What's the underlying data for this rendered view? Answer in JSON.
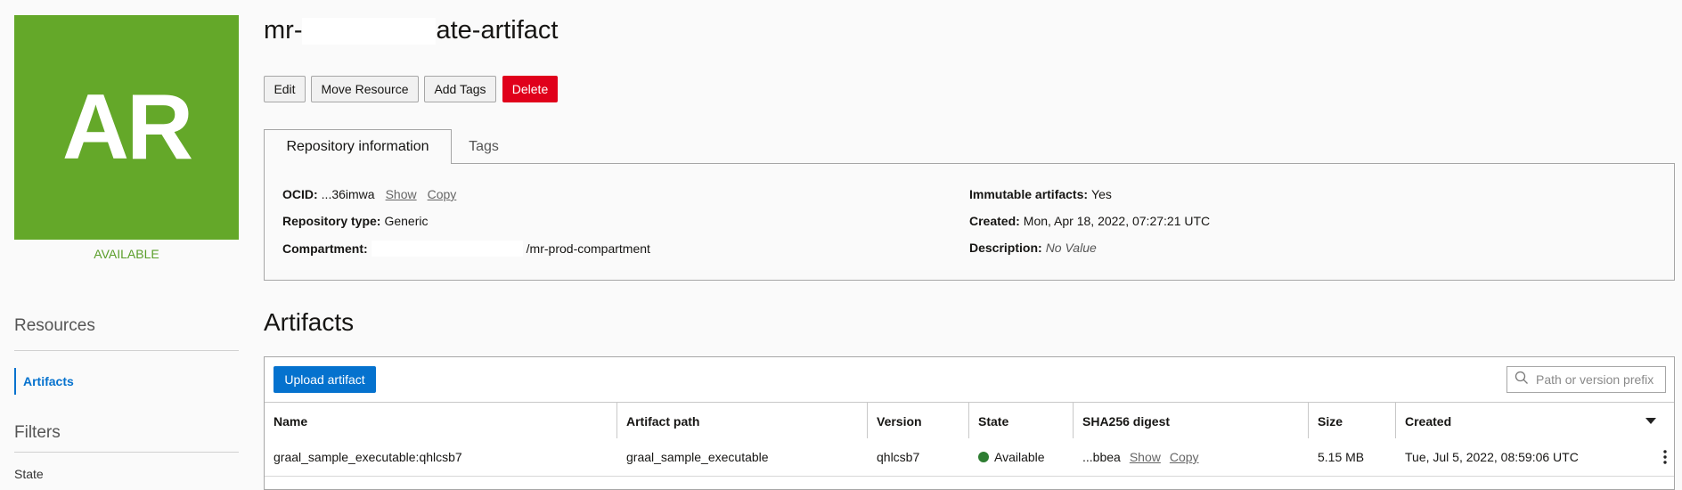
{
  "resource": {
    "avatar_initials": "AR",
    "status": "AVAILABLE",
    "title_prefix": "mr-",
    "title_suffix": "ate-artifact"
  },
  "actions": {
    "edit": "Edit",
    "move": "Move Resource",
    "tags": "Add Tags",
    "delete": "Delete"
  },
  "tabs": {
    "info": "Repository information",
    "tags": "Tags"
  },
  "info": {
    "ocid_label": "OCID:",
    "ocid_value": "...36imwa",
    "show": "Show",
    "copy": "Copy",
    "type_label": "Repository type:",
    "type_value": "Generic",
    "compartment_label": "Compartment:",
    "compartment_value": "/mr-prod-compartment",
    "immutable_label": "Immutable artifacts:",
    "immutable_value": "Yes",
    "created_label": "Created:",
    "created_value": "Mon, Apr 18, 2022, 07:27:21 UTC",
    "description_label": "Description:",
    "description_value": "No Value"
  },
  "sidebar": {
    "resources_heading": "Resources",
    "artifacts_link": "Artifacts",
    "filters_heading": "Filters",
    "state_label": "State"
  },
  "artifacts": {
    "heading": "Artifacts",
    "upload_button": "Upload artifact",
    "search_placeholder": "Path or version prefix",
    "columns": {
      "name": "Name",
      "path": "Artifact path",
      "version": "Version",
      "state": "State",
      "digest": "SHA256 digest",
      "size": "Size",
      "created": "Created"
    },
    "rows": [
      {
        "name": "graal_sample_executable:qhlcsb7",
        "path": "graal_sample_executable",
        "version": "qhlcsb7",
        "state": "Available",
        "digest": "...bbea",
        "show": "Show",
        "copy": "Copy",
        "size": "5.15 MB",
        "created": "Tue, Jul 5, 2022, 08:59:06 UTC"
      }
    ]
  },
  "colors": {
    "avatar_green": "#64a829",
    "primary_blue": "#0572ce",
    "danger_red": "#e0001b",
    "status_green": "#2e7d32"
  },
  "icons": [
    "search-icon",
    "chevron-down-icon",
    "kebab-menu-icon",
    "status-dot-icon"
  ]
}
